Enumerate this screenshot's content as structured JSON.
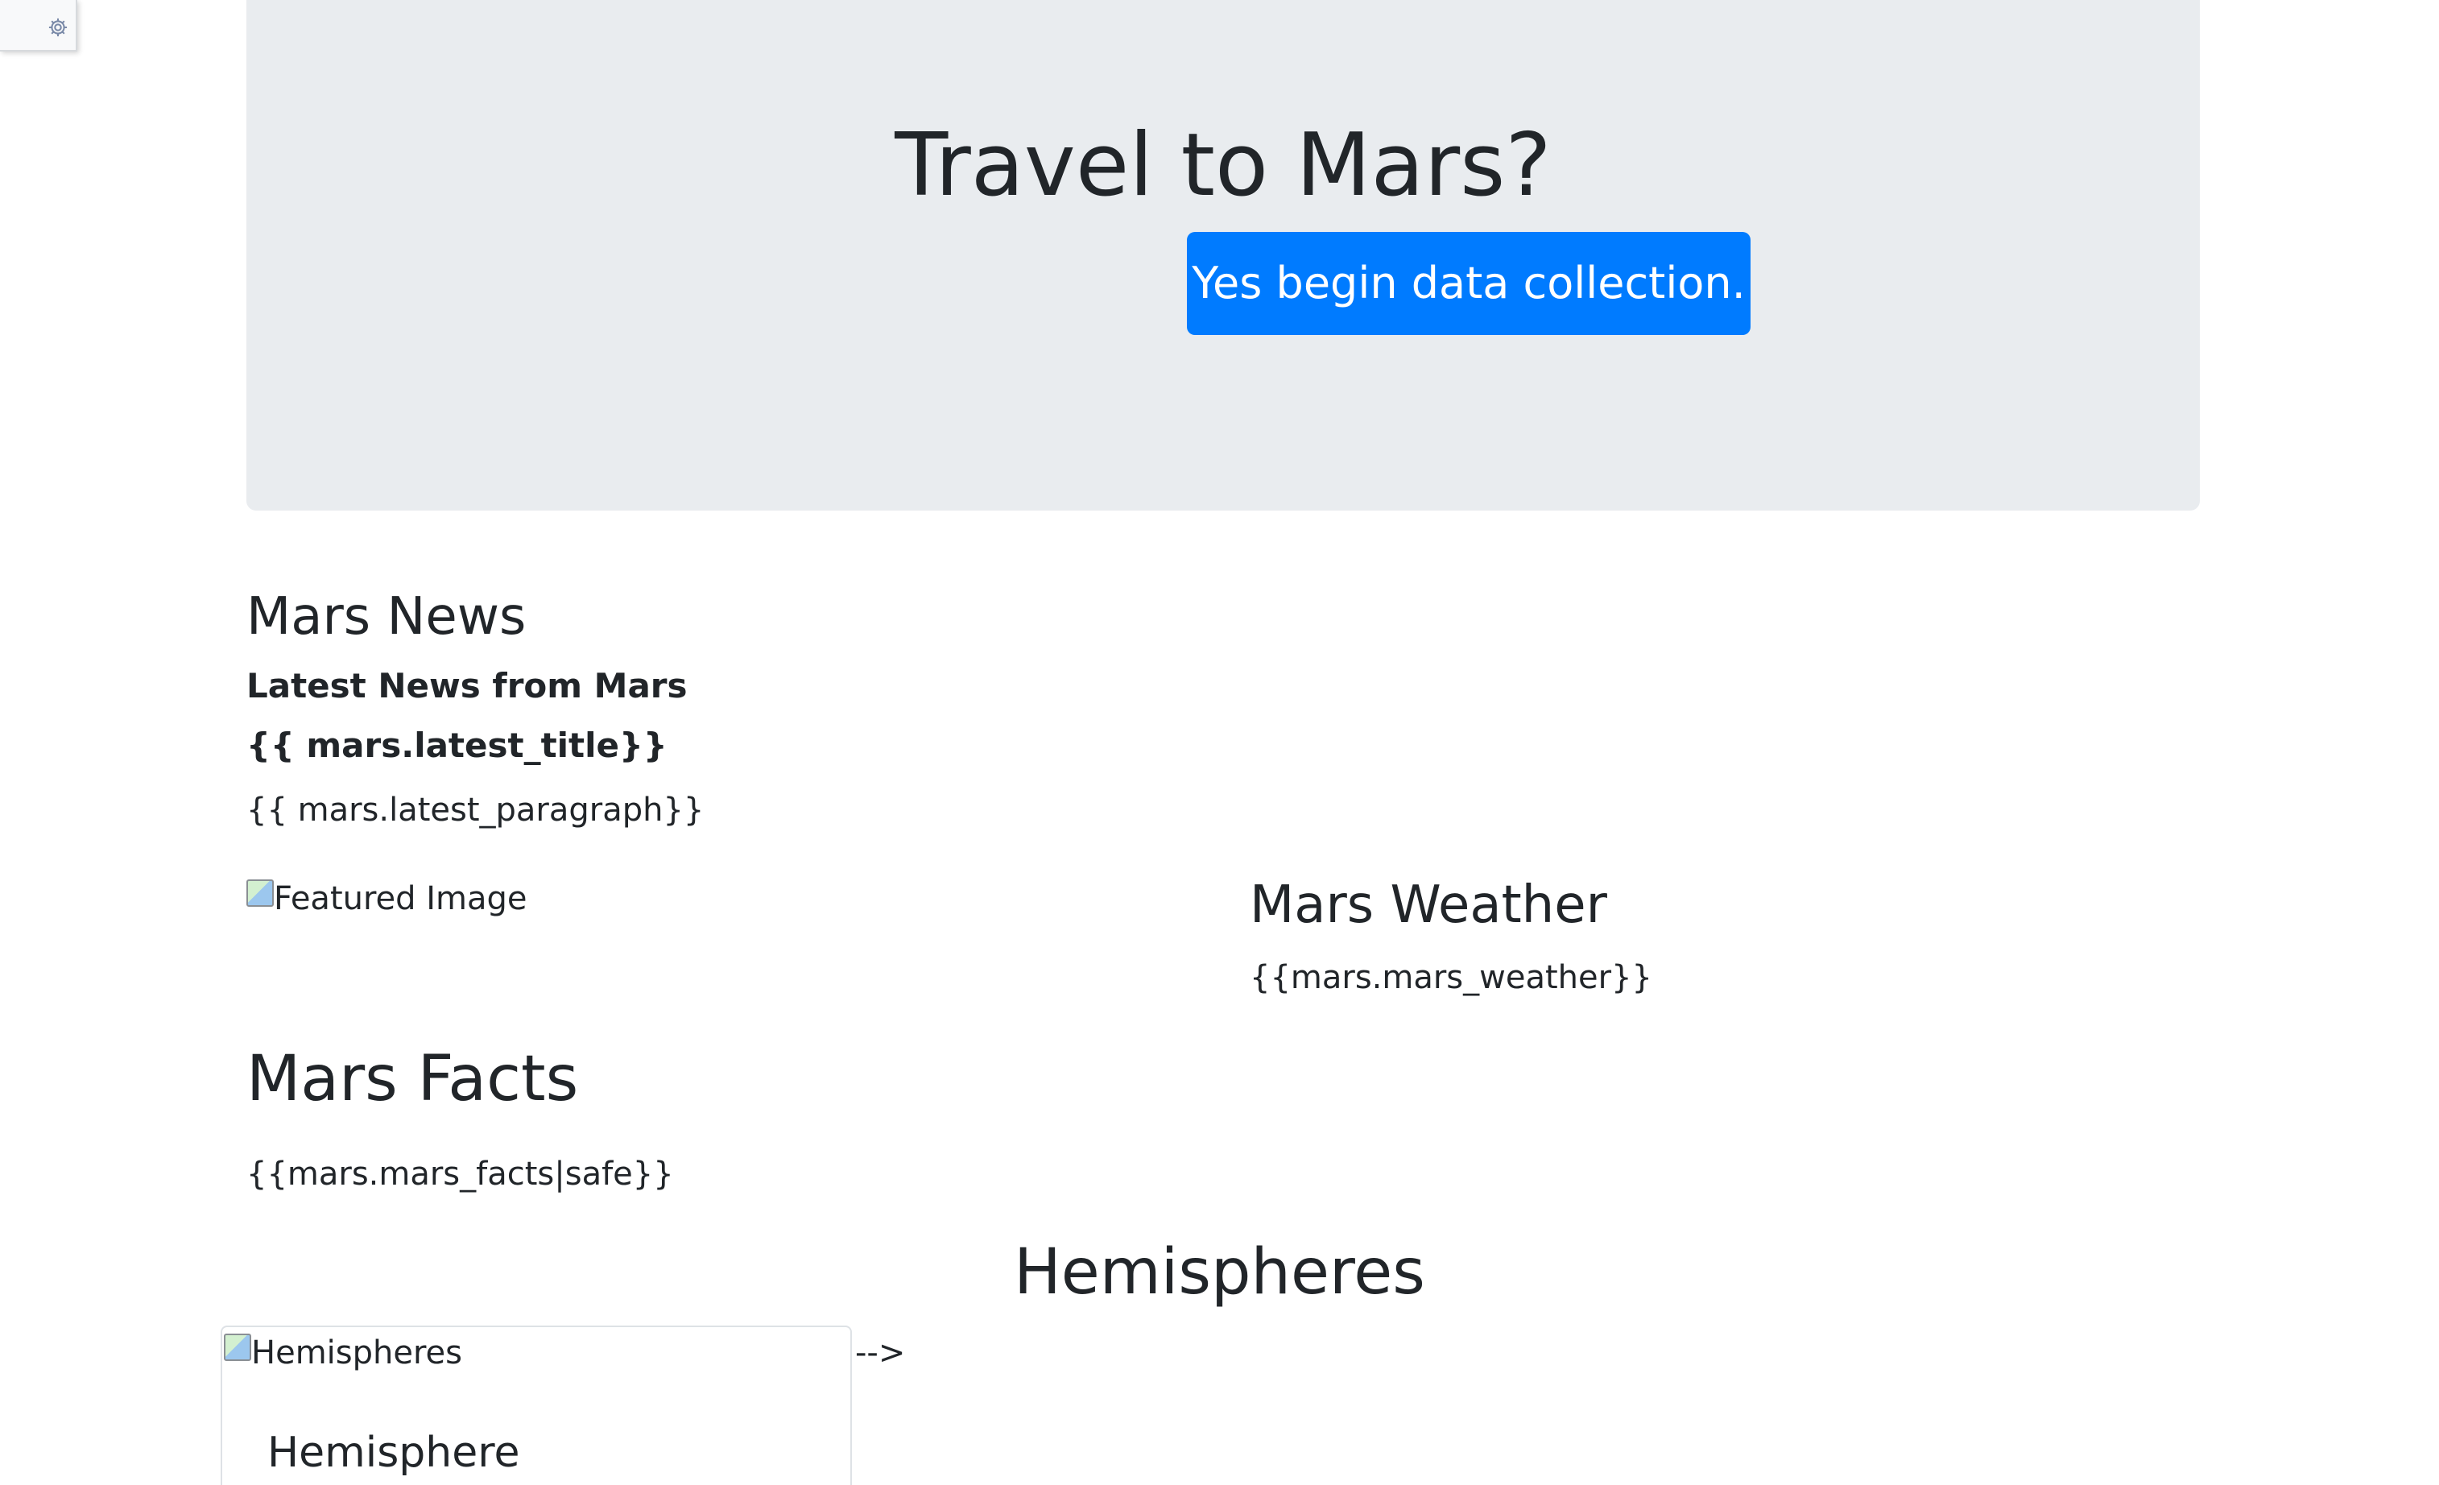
{
  "hero": {
    "title": "Travel to Mars?",
    "button_label": "Yes begin data collection.",
    "button_color": "#007bff",
    "background": "#e9ecef"
  },
  "news": {
    "heading": "Mars News",
    "subheading": "Latest News from Mars",
    "title_placeholder": "{{ mars.latest_title}}",
    "paragraph_placeholder": "{{ mars.latest_paragraph}}"
  },
  "featured_image": {
    "alt": "Featured Image",
    "icon": "broken-image-icon"
  },
  "weather": {
    "heading": "Mars Weather",
    "value": "{{mars.mars_weather}}"
  },
  "facts": {
    "heading": "Mars Facts",
    "value": "{{mars.mars_facts|safe}}"
  },
  "hemispheres": {
    "heading": "Hemispheres",
    "card": {
      "image_alt": "Hemispheres",
      "title": "Hemisphere"
    },
    "trailing_text": "-->"
  },
  "toolbar": {
    "icon": "gear-icon"
  }
}
